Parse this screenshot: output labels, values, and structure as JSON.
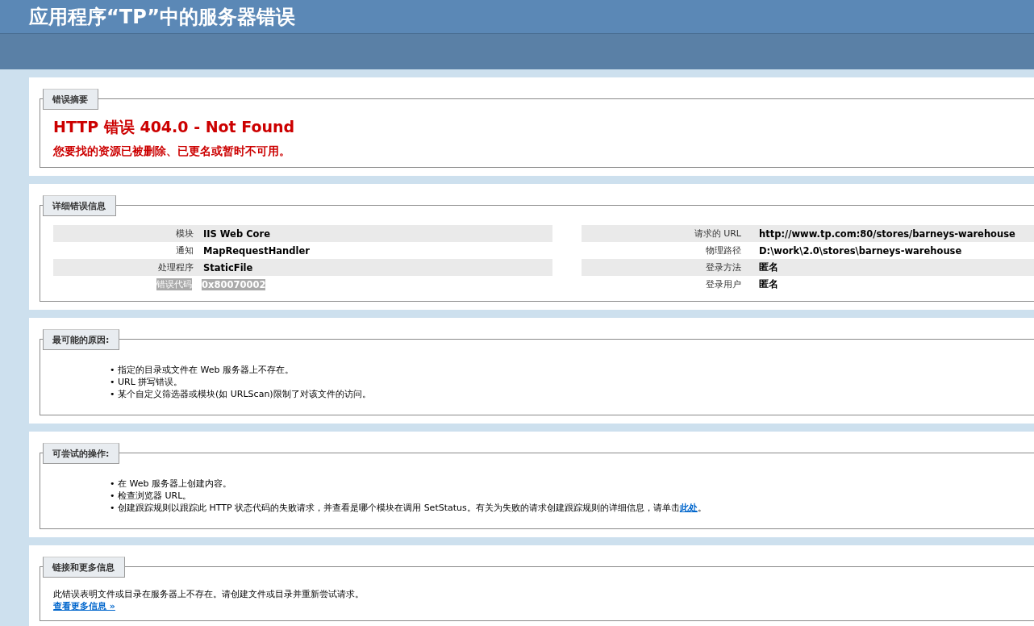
{
  "header": {
    "title": "应用程序“TP”中的服务器错误"
  },
  "summary": {
    "legend": "错误摘要",
    "heading": "HTTP 错误 404.0 - Not Found",
    "message": "您要找的资源已被删除、已更名或暂时不可用。"
  },
  "details": {
    "legend": "详细错误信息",
    "left_rows": [
      {
        "label": "模块",
        "value": "IIS Web Core",
        "highlighted": false
      },
      {
        "label": "通知",
        "value": "MapRequestHandler",
        "highlighted": false
      },
      {
        "label": "处理程序",
        "value": "StaticFile",
        "highlighted": false
      },
      {
        "label": "错误代码",
        "value": "0x80070002",
        "highlighted": true
      }
    ],
    "right_rows": [
      {
        "label": "请求的 URL",
        "value": "http://www.tp.com:80/stores/barneys-warehouse",
        "highlighted": false
      },
      {
        "label": "物理路径",
        "value": "D:\\work\\2.0\\stores\\barneys-warehouse",
        "highlighted": false
      },
      {
        "label": "登录方法",
        "value": "匿名",
        "highlighted": false
      },
      {
        "label": "登录用户",
        "value": "匿名",
        "highlighted": false
      }
    ]
  },
  "causes": {
    "legend": "最可能的原因:",
    "items": [
      {
        "bullet": "•",
        "text": "指定的目录或文件在 Web 服务器上不存在。"
      },
      {
        "bullet": "•",
        "text": "URL 拼写错误。"
      },
      {
        "bullet": "•",
        "text": "某个自定义筛选器或模块(如 URLScan)限制了对该文件的访问。"
      }
    ]
  },
  "actions": {
    "legend": "可尝试的操作:",
    "items": [
      {
        "bullet": "•",
        "text": "在 Web 服务器上创建内容。"
      },
      {
        "bullet": "•",
        "text": "检查浏览器 URL。"
      },
      {
        "bullet": "•",
        "text": "创建跟踪规则以跟踪此 HTTP 状态代码的失败请求，并查看是哪个模块在调用 SetStatus。有关为失败的请求创建跟踪规则的详细信息，请单击",
        "link": "此处",
        "after": "。"
      }
    ]
  },
  "more": {
    "legend": "链接和更多信息",
    "text": "此错误表明文件或目录在服务器上不存在。请创建文件或目录并重新尝试请求。",
    "link": "查看更多信息 »"
  }
}
